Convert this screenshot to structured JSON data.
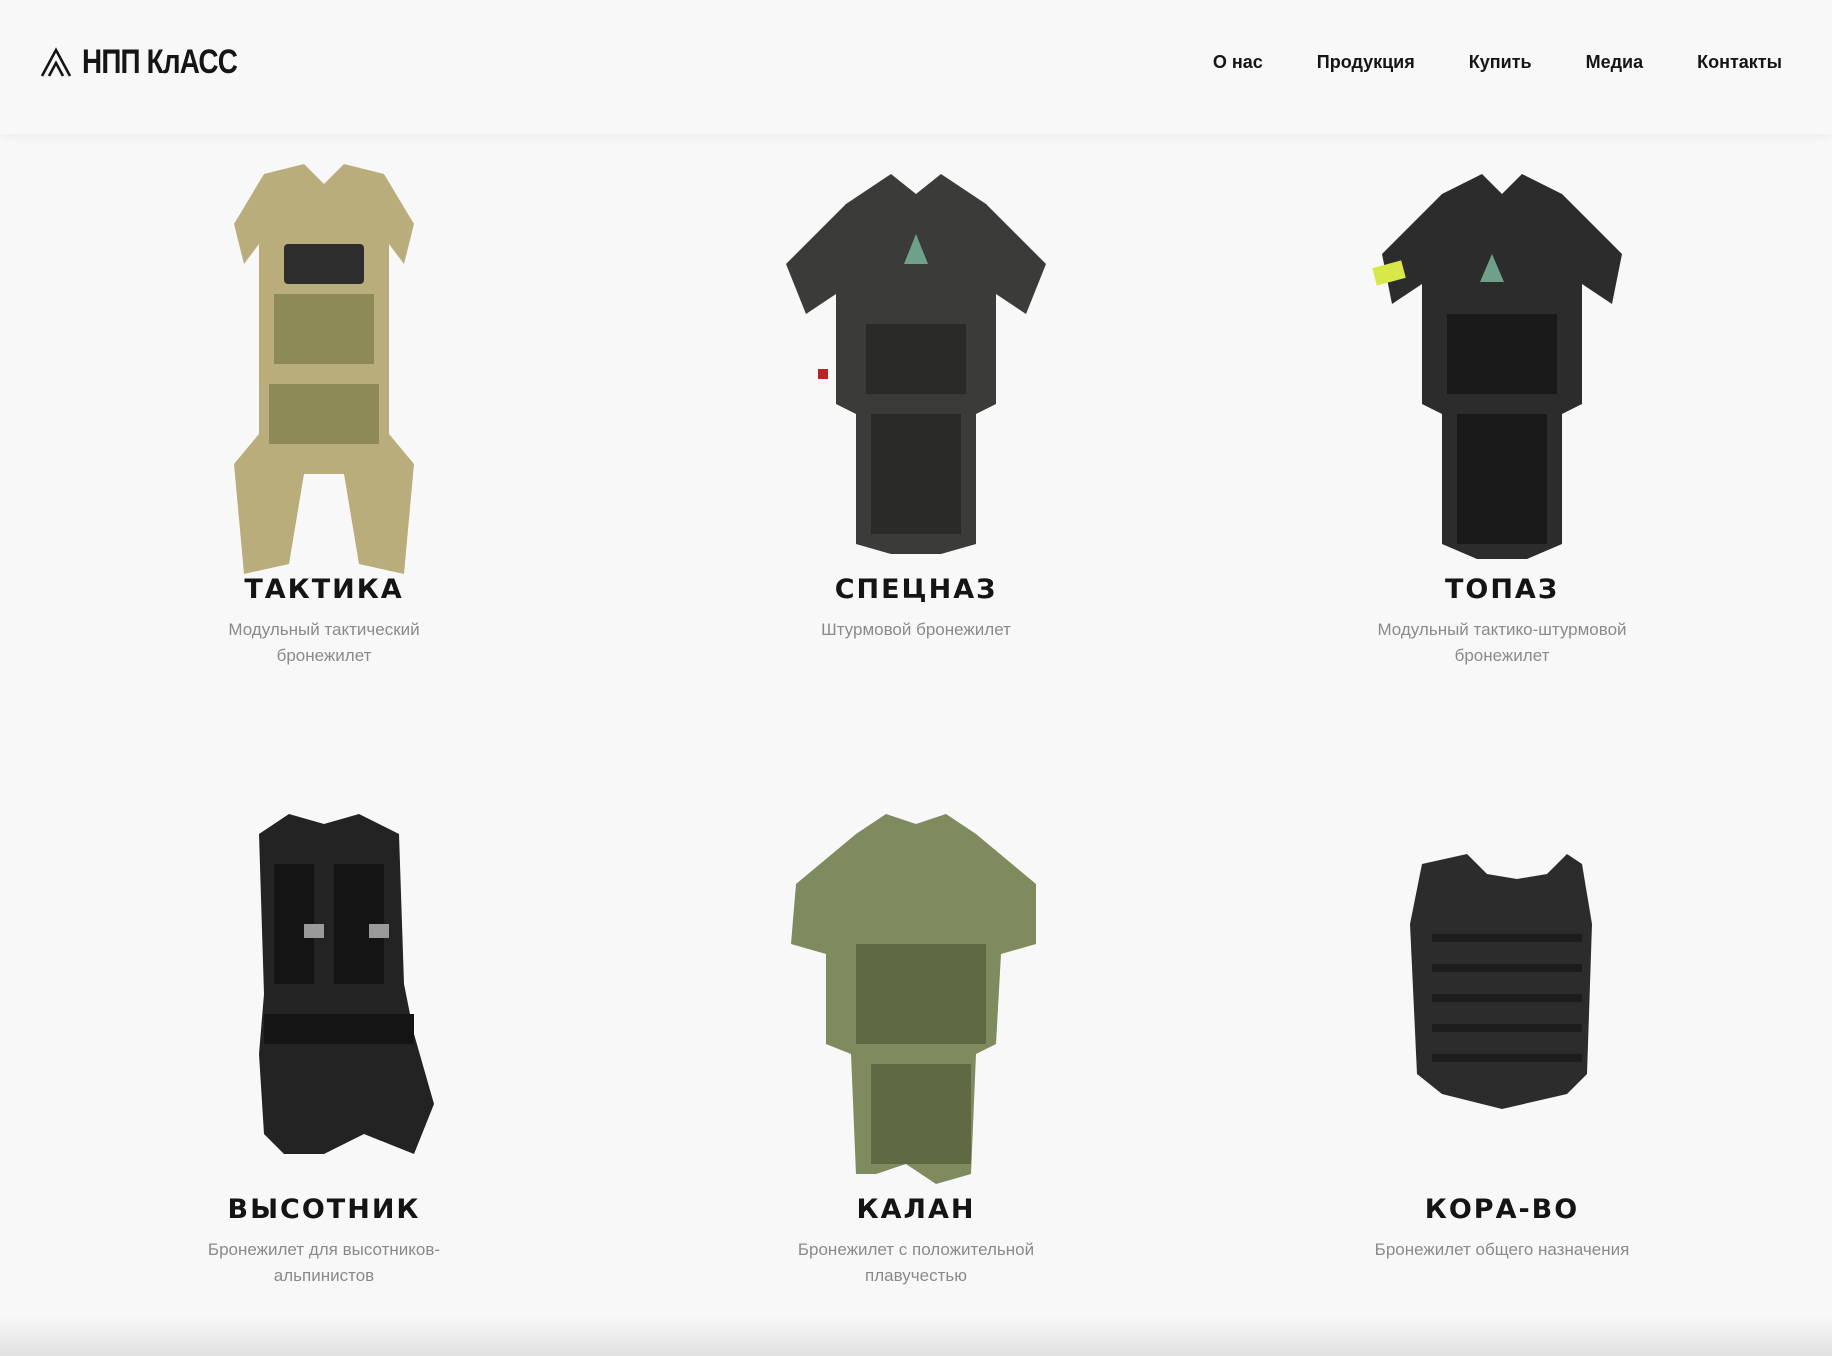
{
  "header": {
    "logo_text": "НПП КлАСС",
    "nav": [
      "О нас",
      "Продукция",
      "Купить",
      "Медиа",
      "Контакты"
    ]
  },
  "products": [
    {
      "title": "ТАКТИКА",
      "desc": "Модульный тактический бронежилет",
      "color": "#b9ad7c",
      "accent": "#8e8a58"
    },
    {
      "title": "СПЕЦНАЗ",
      "desc": "Штурмовой бронежилет",
      "color": "#3b3b3a",
      "accent": "#2a2a29"
    },
    {
      "title": "ТОПАЗ",
      "desc": "Модульный тактико-штурмовой бронежилет",
      "color": "#2c2c2c",
      "accent": "#1a1a1a"
    },
    {
      "title": "ВЫСОТНИК",
      "desc": "Бронежилет для высотников-альпинистов",
      "color": "#232323",
      "accent": "#141414"
    },
    {
      "title": "КАЛАН",
      "desc": "Бронежилет с положительной плавучестью",
      "color": "#7f8a5e",
      "accent": "#5f6a45"
    },
    {
      "title": "КОРА-ВО",
      "desc": "Бронежилет общего назначения",
      "color": "#2b2c2b",
      "accent": "#1c1d1c"
    }
  ]
}
